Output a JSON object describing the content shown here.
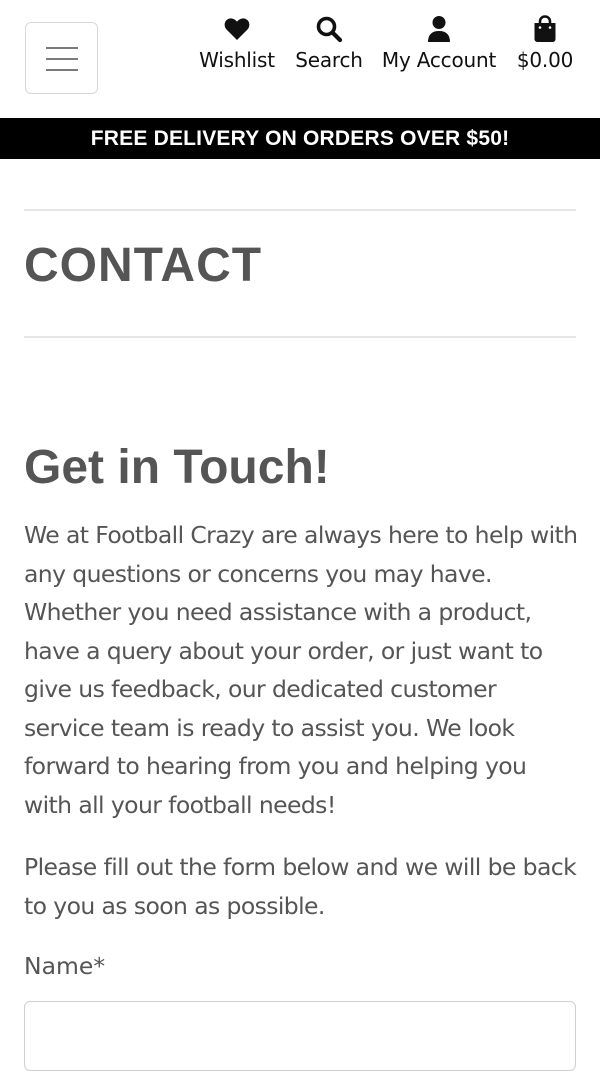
{
  "header": {
    "menu_button": "menu",
    "nav": [
      {
        "label": "Wishlist",
        "icon": "heart-icon"
      },
      {
        "label": "Search",
        "icon": "search-icon"
      },
      {
        "label": "My Account",
        "icon": "user-icon"
      },
      {
        "label": "$0.00",
        "icon": "shopping-bag-icon"
      }
    ]
  },
  "banner": {
    "text": "FREE DELIVERY ON ORDERS OVER $50!"
  },
  "page": {
    "title": "CONTACT"
  },
  "section": {
    "title": "Get in Touch!",
    "paragraph_1": "We at Football Crazy are always here to help with any questions or concerns you may have. Whether you need assistance with a product, have a query about your order, or just want to give us feedback, our dedicated customer service team is ready to assist you. We look forward to hearing from you and helping you with all your football needs!",
    "paragraph_2": "Please fill out the form below and we will be back to you as soon as possible."
  },
  "form": {
    "name_label": "Name*",
    "name_value": "",
    "name_placeholder": ""
  },
  "colors": {
    "text": "#555555",
    "banner_bg": "#000000",
    "banner_text": "#ffffff",
    "icon": "#111111"
  }
}
